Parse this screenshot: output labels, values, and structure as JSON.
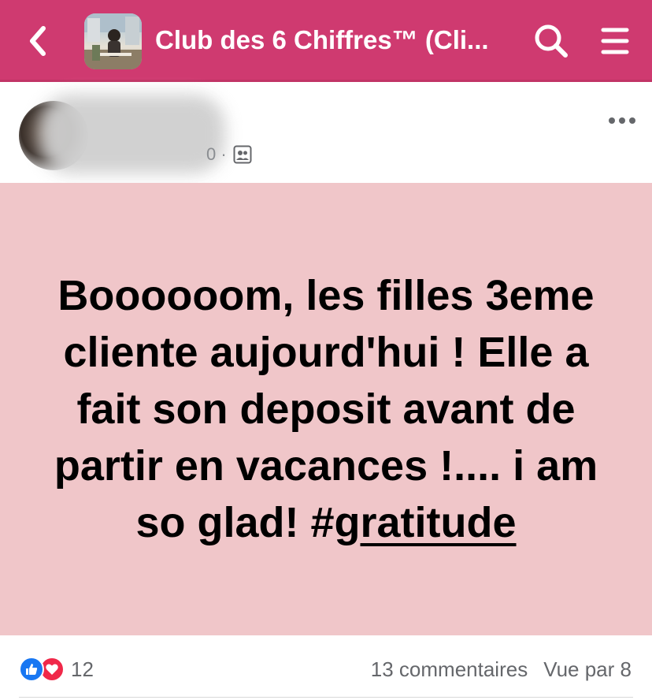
{
  "header": {
    "title": "Club des 6 Chiffres™ (Cli...",
    "icons": {
      "back": "chevron-left-icon",
      "search": "search-icon",
      "menu": "hamburger-menu-icon"
    },
    "colors": {
      "bar": "#cf3a70",
      "icon": "#ffffff"
    }
  },
  "post": {
    "meta_visible": "0 ·",
    "audience_icon": "group-members-icon",
    "more_icon": "more-dots-icon",
    "text_main": "Boooooom, les filles 3eme cliente aujourd'hui ! Elle a fait son deposit avant de partir en vacances !.... i am so glad! #g",
    "text_hashtag": "ratitude",
    "background_color": "#f0c6c9"
  },
  "footer": {
    "reaction_icons": [
      "like-icon",
      "love-icon"
    ],
    "reaction_count": "12",
    "comments": "13 commentaires",
    "seen_by": "Vue par 8"
  }
}
